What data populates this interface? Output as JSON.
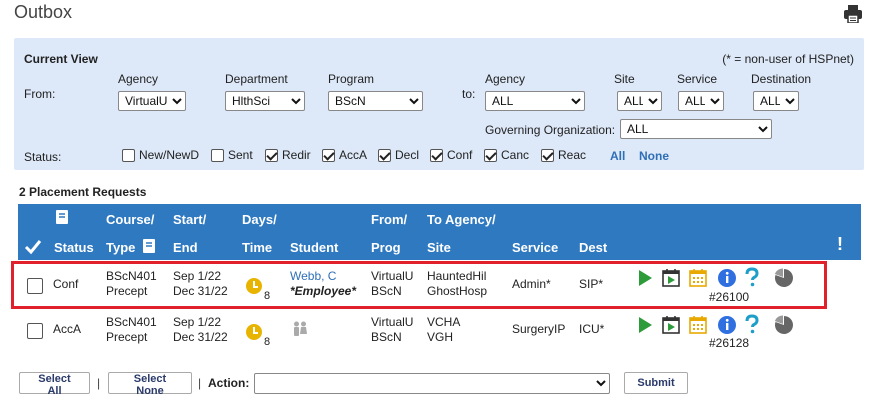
{
  "page": {
    "title": "Outbox"
  },
  "filter": {
    "current_view_label": "Current View",
    "non_user_note": "(* = non-user of HSPnet)",
    "from_label": "From:",
    "to_label": "to:",
    "from": {
      "agency_label": "Agency",
      "agency_value": "VirtualU",
      "department_label": "Department",
      "department_value": "HlthSci",
      "program_label": "Program",
      "program_value": "BScN"
    },
    "to": {
      "agency_label": "Agency",
      "agency_value": "ALL",
      "site_label": "Site",
      "site_value": "ALL",
      "service_label": "Service",
      "service_value": "ALL",
      "destination_label": "Destination",
      "destination_value": "ALL",
      "gov_org_label": "Governing Organization:",
      "gov_org_value": "ALL"
    },
    "status_label": "Status:",
    "statuses": [
      {
        "label": "New/NewD",
        "checked": false
      },
      {
        "label": "Sent",
        "checked": false
      },
      {
        "label": "Redir",
        "checked": true
      },
      {
        "label": "AccA",
        "checked": true
      },
      {
        "label": "Decl",
        "checked": true
      },
      {
        "label": "Conf",
        "checked": true
      },
      {
        "label": "Canc",
        "checked": true
      },
      {
        "label": "Reac",
        "checked": true
      }
    ],
    "all_link": "All",
    "none_link": "None"
  },
  "results": {
    "count_label": "2 Placement Requests",
    "headers": {
      "status": "Status",
      "course": "Course/",
      "type": "Type",
      "start": "Start/",
      "end": "End",
      "days": "Days/",
      "time": "Time",
      "student": "Student",
      "from": "From/",
      "prog": "Prog",
      "to_agency": "To Agency/",
      "site": "Site",
      "service": "Service",
      "dest": "Dest",
      "alert": "!"
    },
    "rows": [
      {
        "status": "Conf",
        "course": "BScN401",
        "type": "Precept",
        "start": "Sep 1/22",
        "end": "Dec 31/22",
        "days": "8",
        "student_name": "Webb, C",
        "student_role": "*Employee*",
        "from": "VirtualU",
        "prog": "BScN",
        "to_agency": "HauntedHil",
        "site": "GhostHosp",
        "service": "Admin*",
        "dest": "SIP*",
        "ref": "#26100"
      },
      {
        "status": "AccA",
        "course": "BScN401",
        "type": "Precept",
        "start": "Sep 1/22",
        "end": "Dec 31/22",
        "days": "8",
        "from": "VirtualU",
        "prog": "BScN",
        "to_agency": "VCHA",
        "site": "VGH",
        "service": "SurgeryIP",
        "dest": "ICU*",
        "ref": "#26128"
      }
    ]
  },
  "footer": {
    "select_all": "Select All",
    "select_none": "Select None",
    "sep1": "|",
    "sep2": "|",
    "action_label": "Action:",
    "action_value": "",
    "submit": "Submit"
  },
  "colors": {
    "header_blue": "#2f79c1",
    "panel_bg": "#dde8f8",
    "highlight_red": "#e0202a",
    "play_green": "#2e9b3a",
    "info_blue": "#2f6fe0",
    "help_teal": "#1e9fc8",
    "clock_yellow": "#e8b400"
  },
  "icons": [
    "print-icon",
    "book-icon",
    "checkmark-icon",
    "alert-icon",
    "clock-icon",
    "play-icon",
    "calendar-play-icon",
    "calendar-icon",
    "info-icon",
    "help-icon",
    "pie-chart-icon",
    "people-icon"
  ]
}
